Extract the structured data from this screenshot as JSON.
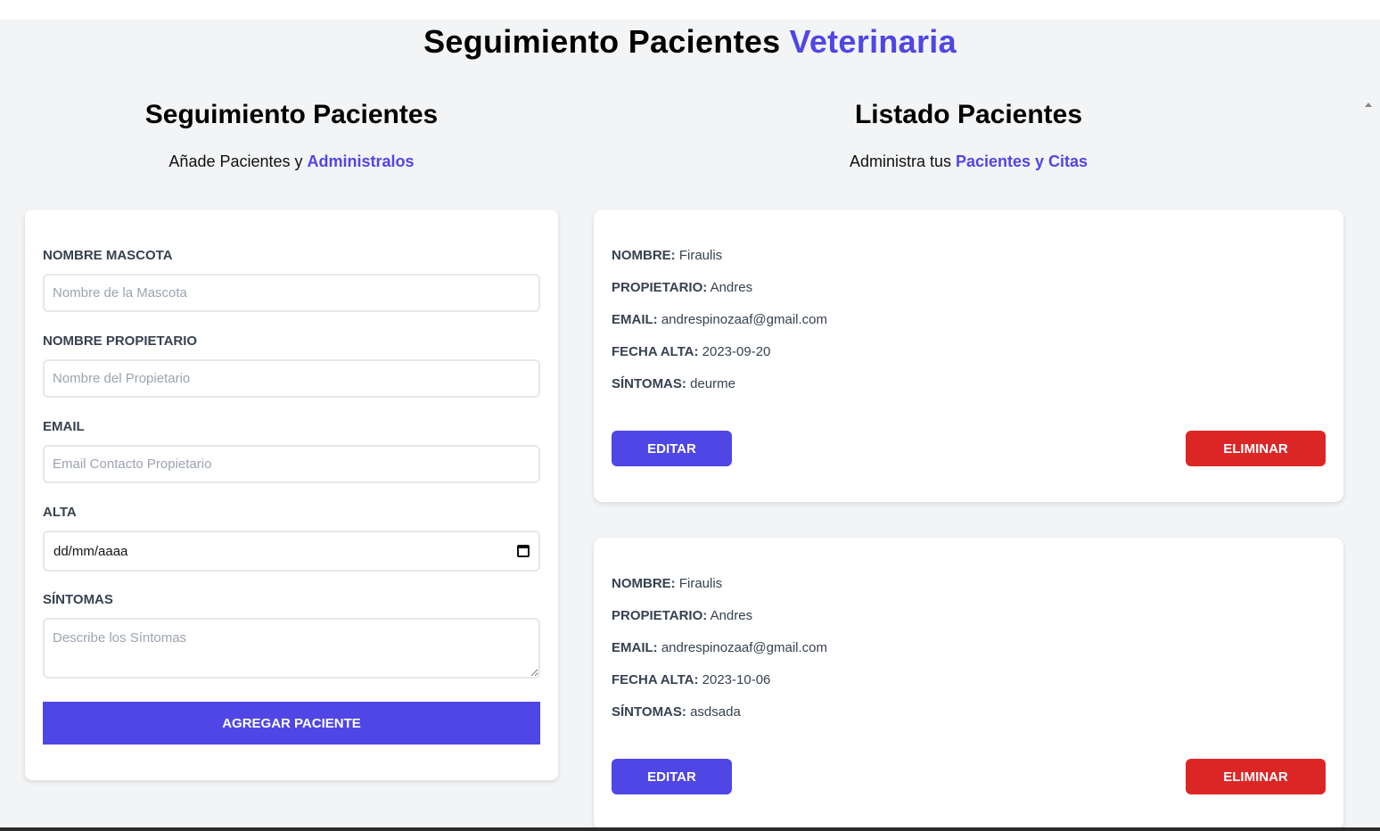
{
  "header": {
    "title_main": "Seguimiento Pacientes",
    "title_accent": "Veterinaria"
  },
  "form_section": {
    "title": "Seguimiento Pacientes",
    "subtitle_text": "Añade Pacientes y ",
    "subtitle_accent": "Administralos",
    "fields": {
      "pet_label": "Nombre Mascota",
      "pet_placeholder": "Nombre de la Mascota",
      "owner_label": "Nombre Propietario",
      "owner_placeholder": "Nombre del Propietario",
      "email_label": "Email",
      "email_placeholder": "Email Contacto Propietario",
      "date_label": "Alta",
      "date_value": "dd/mm/aaaa",
      "symptoms_label": "Síntomas",
      "symptoms_placeholder": "Describe los Síntomas"
    },
    "submit_label": "Agregar Paciente"
  },
  "list_section": {
    "title": "Listado Pacientes",
    "subtitle_text": "Administra tus ",
    "subtitle_accent": "Pacientes y Citas"
  },
  "field_keys": {
    "name": "Nombre:",
    "owner": "Propietario:",
    "email": "Email:",
    "date": "Fecha Alta:",
    "symptoms": "Síntomas:"
  },
  "patients": [
    {
      "name": "Firaulis",
      "owner": "Andres",
      "email": "andrespinozaaf@gmail.com",
      "date": "2023-09-20",
      "symptoms": "deurme",
      "edit_label": "Editar",
      "delete_label": "Eliminar"
    },
    {
      "name": "Firaulis",
      "owner": "Andres",
      "email": "andrespinozaaf@gmail.com",
      "date": "2023-10-06",
      "symptoms": "asdsada",
      "edit_label": "Editar",
      "delete_label": "Eliminar"
    }
  ],
  "colors": {
    "accent": "#4f46e5",
    "danger": "#dc2626",
    "background": "#f3f4f6"
  }
}
